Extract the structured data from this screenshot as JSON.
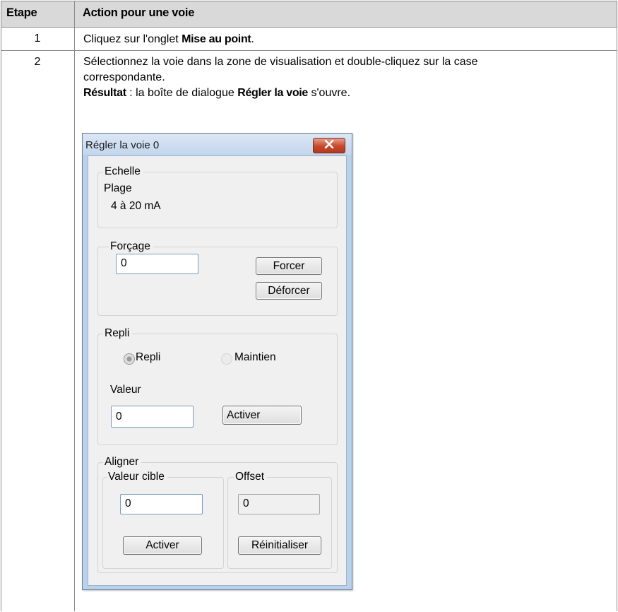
{
  "table": {
    "headers": {
      "step": "Etape",
      "action": "Action pour une voie"
    },
    "rows": [
      {
        "step": "1",
        "action": {
          "pre": "Cliquez sur l'onglet ",
          "bold": "Mise au point",
          "post": "."
        }
      },
      {
        "step": "2",
        "action_line1": "Sélectionnez la voie dans la zone de visualisation et double-cliquez sur la case",
        "action_line2": "correspondante.",
        "result_label": "Résultat",
        "result_mid": " : la boîte de dialogue ",
        "result_bold": "Régler la voie",
        "result_post": " s'ouvre."
      }
    ]
  },
  "dialog": {
    "title": "Régler la voie 0",
    "close_icon": "close-icon",
    "echelle": {
      "legend": "Echelle",
      "label": "Plage",
      "value": "4 à 20 mA"
    },
    "forcage": {
      "legend": "Forçage",
      "value": "0",
      "force_label": "Forcer",
      "unforce_label": "Déforcer"
    },
    "repli": {
      "legend": "Repli",
      "radio_repli": "Repli",
      "radio_maintien": "Maintien",
      "selected": "Repli",
      "value_label": "Valeur",
      "value": "0",
      "apply_label": "Activer"
    },
    "aligner": {
      "legend": "Aligner",
      "target": {
        "legend": "Valeur cible",
        "value": "0",
        "apply_label": "Activer"
      },
      "offset": {
        "legend": "Offset",
        "value": "0",
        "reset_label": "Réinitialiser"
      }
    }
  },
  "colors": {
    "header_bg": "#d9d9d9",
    "grid_line": "#8c8c8c",
    "dialog_frame": "#b9d1ea",
    "client_bg": "#f0f0f0",
    "close_button": "#c8482b"
  }
}
